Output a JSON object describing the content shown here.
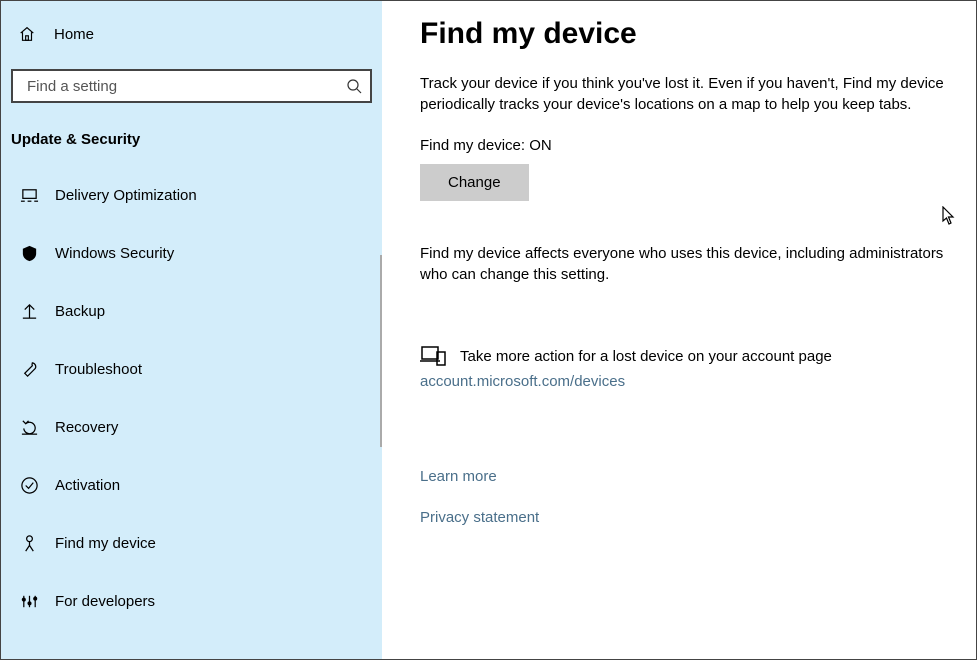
{
  "sidebar": {
    "home_label": "Home",
    "search_placeholder": "Find a setting",
    "category_header": "Update & Security",
    "items": [
      {
        "label": "Delivery Optimization"
      },
      {
        "label": "Windows Security"
      },
      {
        "label": "Backup"
      },
      {
        "label": "Troubleshoot"
      },
      {
        "label": "Recovery"
      },
      {
        "label": "Activation"
      },
      {
        "label": "Find my device"
      },
      {
        "label": "For developers"
      }
    ]
  },
  "main": {
    "title": "Find my device",
    "description": "Track your device if you think you've lost it. Even if you haven't, Find my device periodically tracks your device's locations on a map to help you keep tabs.",
    "status_label": "Find my device: ON",
    "change_button": "Change",
    "note": "Find my device affects everyone who uses this device, including administrators who can change this setting.",
    "action_text": "Take more action for a lost device on your account page",
    "action_link": "account.microsoft.com/devices",
    "learn_more": "Learn more",
    "privacy": "Privacy statement"
  }
}
